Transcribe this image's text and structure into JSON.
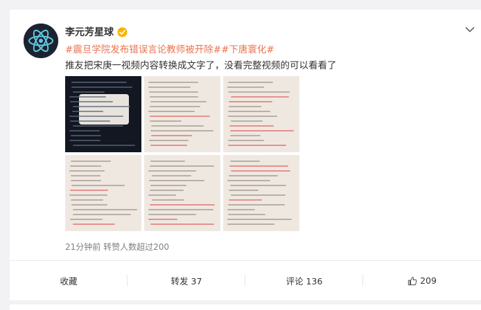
{
  "post": {
    "username": "李元芳星球",
    "topics": [
      "#震旦学院发布错误言论教师被开除#",
      "#下唐寰化#"
    ],
    "text": "推友把宋庚一视频内容转换成文字了，没看完整视频的可以看看了",
    "meta": "21分钟前 转赞人数超过200"
  },
  "actions": {
    "favorite_label": "收藏",
    "repost_label": "转发 37",
    "comment_label": "评论 136",
    "like_label": "209"
  },
  "colors": {
    "topic": "#eb7350",
    "verified": "#f7b500",
    "annotation_red": "#d94a4a",
    "paper": "#efe8e1"
  },
  "icons": {
    "avatar": "atom-logo-icon",
    "verified": "verified-badge-icon",
    "menu": "chevron-down-icon",
    "like": "thumbs-up-icon"
  }
}
